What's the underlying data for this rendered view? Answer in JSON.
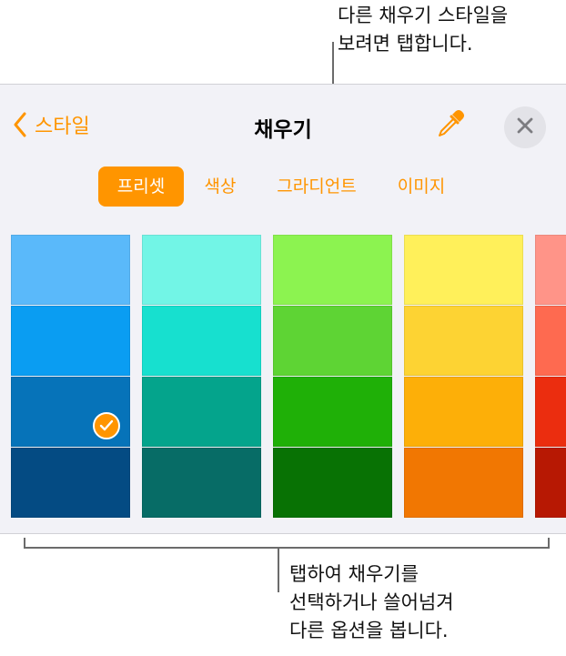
{
  "callouts": {
    "top_line1": "다른 채우기 스타일을",
    "top_line2": "보려면 탭합니다.",
    "bottom_line1": "탭하여 채우기를",
    "bottom_line2": "선택하거나 쓸어넘겨",
    "bottom_line3": "다른 옵션을 봅니다."
  },
  "header": {
    "back_label": "스타일",
    "title": "채우기",
    "back_icon": "chevron-left-icon",
    "eyedropper_icon": "eyedropper-icon",
    "close_icon": "close-icon"
  },
  "tabs": [
    {
      "label": "프리셋",
      "active": true
    },
    {
      "label": "색상",
      "active": false
    },
    {
      "label": "그라디언트",
      "active": false
    },
    {
      "label": "이미지",
      "active": false
    }
  ],
  "swatches": [
    [
      "#5ab9fa",
      "#0a9df2",
      "#0673b9",
      "#044b83"
    ],
    [
      "#72f5e6",
      "#17e0cf",
      "#04a48c",
      "#076c66"
    ],
    [
      "#8cf350",
      "#5ed434",
      "#1fb007",
      "#087204"
    ],
    [
      "#fff05a",
      "#fdd333",
      "#fdaf08",
      "#f17702"
    ],
    [
      "#ff9488",
      "#fe6a50",
      "#eb2d0f",
      "#b71803"
    ]
  ],
  "selected_swatch": {
    "column": 0,
    "row": 2
  },
  "colors": {
    "accent": "#ff9500",
    "panel_bg": "#f2f2f7"
  }
}
